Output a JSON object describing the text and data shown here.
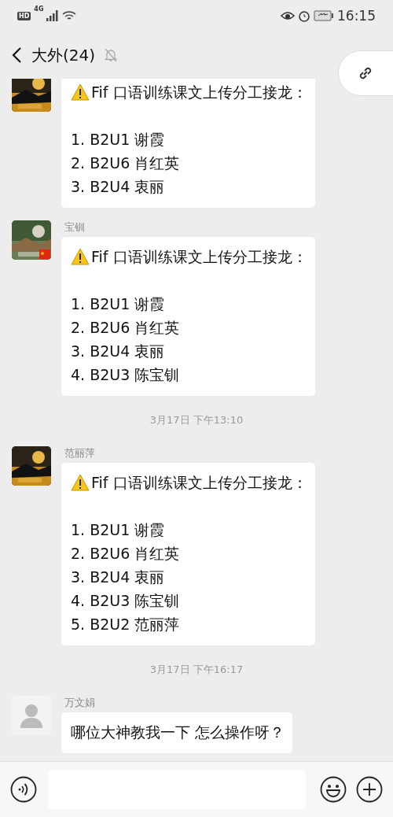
{
  "status_bar": {
    "hd": "HD",
    "network": "4G",
    "time": "16:15"
  },
  "header": {
    "title": "大外(24)",
    "muted": true
  },
  "messages": [
    {
      "kind": "message",
      "default_avatar": false,
      "title": "Fif 口语训练课文上传分工接龙：",
      "items": [
        "1. B2U1 谢霞",
        "2. B2U6 肖红英",
        "3. B2U4 衷丽"
      ]
    },
    {
      "kind": "message",
      "sender": "宝钏",
      "default_avatar": false,
      "badge": true,
      "title": "Fif 口语训练课文上传分工接龙：",
      "items": [
        "1. B2U1 谢霞",
        "2. B2U6 肖红英",
        "3. B2U4 衷丽",
        "4. B2U3 陈宝钏"
      ]
    },
    {
      "kind": "time",
      "text": "3月17日 下午13:10"
    },
    {
      "kind": "message",
      "sender": "范丽萍",
      "default_avatar": false,
      "title": "Fif 口语训练课文上传分工接龙：",
      "items": [
        "1. B2U1 谢霞",
        "2. B2U6 肖红英",
        "3. B2U4 衷丽",
        "4. B2U3 陈宝钏",
        "5. B2U2 范丽萍"
      ]
    },
    {
      "kind": "time",
      "text": "3月17日 下午16:17"
    },
    {
      "kind": "text",
      "sender": "万文娟",
      "default_avatar": true,
      "text": "哪位大神教我一下 怎么操作呀？"
    }
  ]
}
